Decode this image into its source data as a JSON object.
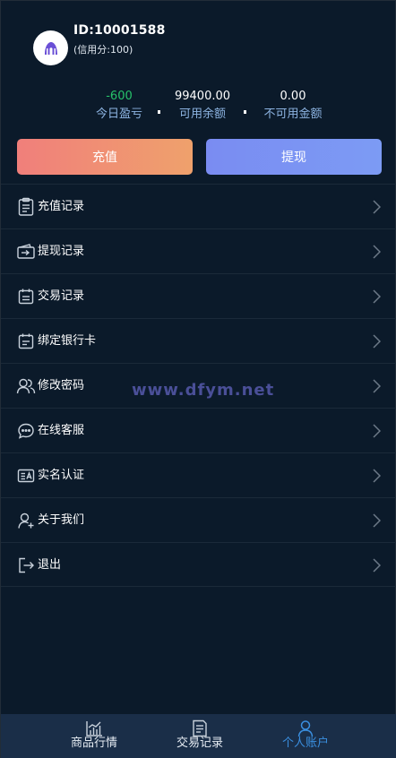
{
  "user": {
    "id_label": "ID:10001588",
    "credit_label": "(信用分:100)"
  },
  "stats": {
    "today_profit": {
      "value": "-600",
      "label": "今日盈亏"
    },
    "available": {
      "value": "99400.00",
      "label": "可用余额"
    },
    "unavailable": {
      "value": "0.00",
      "label": "不可用金额"
    }
  },
  "actions": {
    "recharge": "充值",
    "withdraw": "提现"
  },
  "menu": [
    {
      "label": "充值记录",
      "icon": "clipboard-icon"
    },
    {
      "label": "提现记录",
      "icon": "wallet-transfer-icon"
    },
    {
      "label": "交易记录",
      "icon": "calendar-list-icon"
    },
    {
      "label": "绑定银行卡",
      "icon": "calendar-card-icon"
    },
    {
      "label": "修改密码",
      "icon": "users-icon"
    },
    {
      "label": "在线客服",
      "icon": "chat-bubble-icon"
    },
    {
      "label": "实名认证",
      "icon": "id-card-icon"
    },
    {
      "label": "关于我们",
      "icon": "user-add-icon"
    },
    {
      "label": "退出",
      "icon": "logout-icon"
    }
  ],
  "watermark": "www.dfym.net",
  "tabs": {
    "market": "商品行情",
    "trade": "交易记录",
    "account": "个人账户"
  },
  "colors": {
    "background": "#0b1a2a",
    "profit_green": "#27c26a",
    "stat_label_blue": "#8db4e2",
    "recharge_gradient_start": "#f07f7b",
    "recharge_gradient_end": "#efa16c",
    "withdraw_gradient_start": "#7a8cf2",
    "withdraw_gradient_end": "#7c9bf4",
    "tabbar_bg": "#1a2e48",
    "tab_active": "#3a8fe0",
    "watermark": "#4a4f98"
  }
}
